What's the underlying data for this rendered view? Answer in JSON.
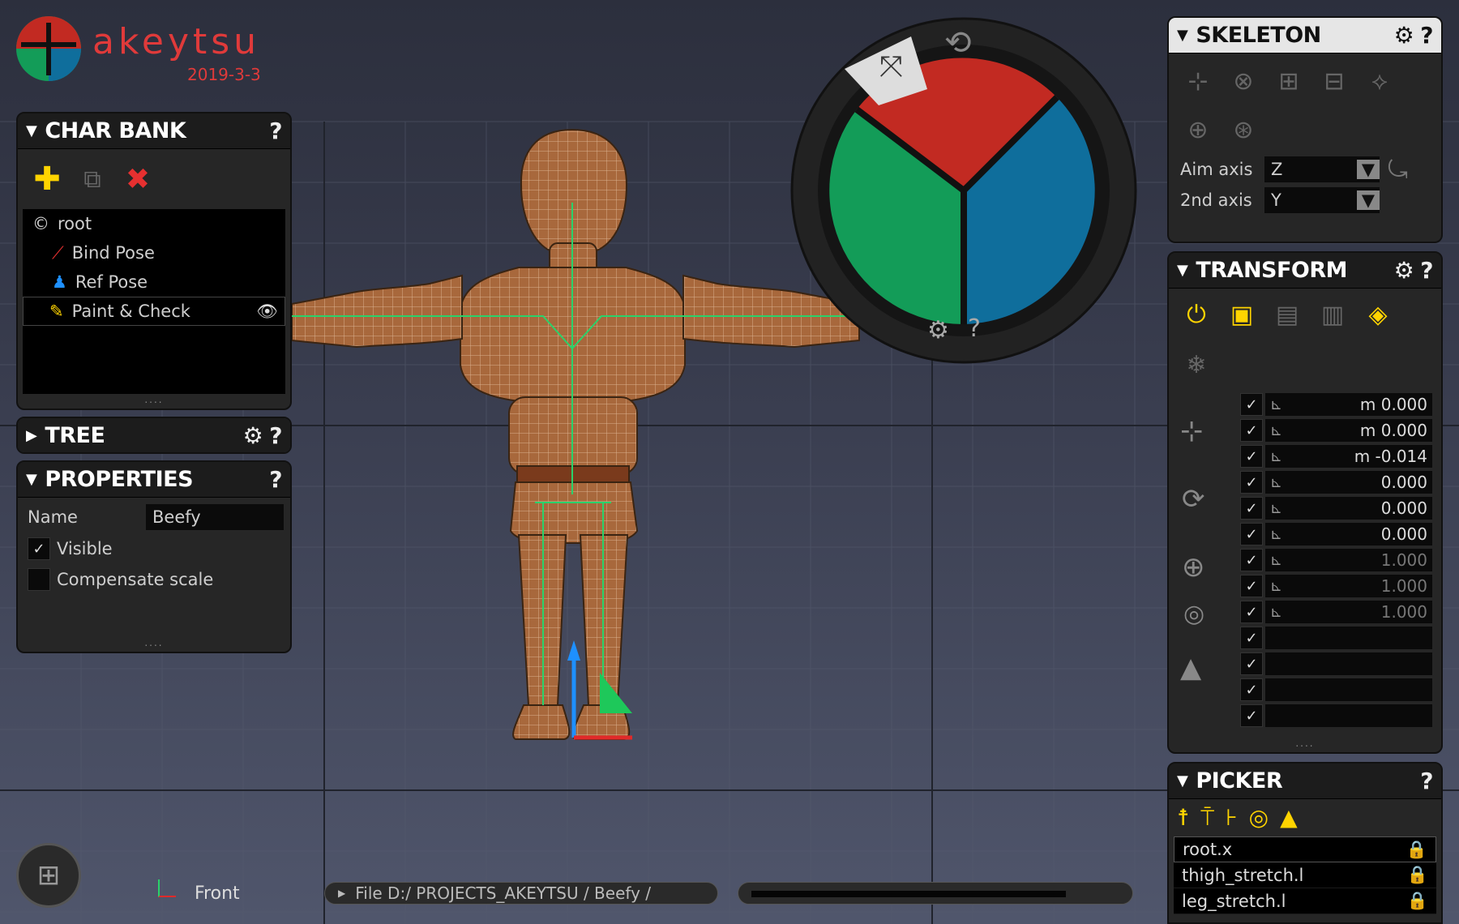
{
  "app": {
    "brand": "akeytsu",
    "version": "2019-3-3",
    "brand_color": "#e03a3a"
  },
  "charbank": {
    "title": "CHAR BANK",
    "help": "?",
    "items": [
      {
        "label": "root",
        "icon": "root-icon"
      },
      {
        "label": "Bind Pose",
        "icon": "bone-icon"
      },
      {
        "label": "Ref Pose",
        "icon": "figure-icon"
      },
      {
        "label": "Paint & Check",
        "icon": "paint-icon"
      }
    ]
  },
  "tree": {
    "title": "TREE",
    "help": "?"
  },
  "properties": {
    "title": "PROPERTIES",
    "help": "?",
    "name_label": "Name",
    "name_value": "Beefy",
    "visible_label": "Visible",
    "visible_checked": true,
    "compensate_label": "Compensate scale",
    "compensate_checked": false
  },
  "skeleton": {
    "title": "SKELETON",
    "help": "?",
    "aim_label": "Aim axis",
    "aim_value": "Z",
    "second_label": "2nd axis",
    "second_value": "Y"
  },
  "transform": {
    "title": "TRANSFORM",
    "help": "?",
    "translate": [
      "m 0.000",
      "m 0.000",
      "m -0.014"
    ],
    "rotate": [
      "0.000",
      "0.000",
      "0.000"
    ],
    "scale": [
      "1.000",
      "1.000",
      "1.000"
    ]
  },
  "picker": {
    "title": "PICKER",
    "help": "?",
    "items": [
      "root.x",
      "thigh_stretch.l",
      "leg_stretch.l"
    ]
  },
  "wheel": {
    "help": "?",
    "colors": {
      "red": "#c22a22",
      "green": "#139c58",
      "blue": "#0f6e9c"
    }
  },
  "viewport": {
    "view_label": "Front"
  },
  "statusbar": {
    "path": "File D:/ PROJECTS_AKEYTSU / Beefy /"
  }
}
